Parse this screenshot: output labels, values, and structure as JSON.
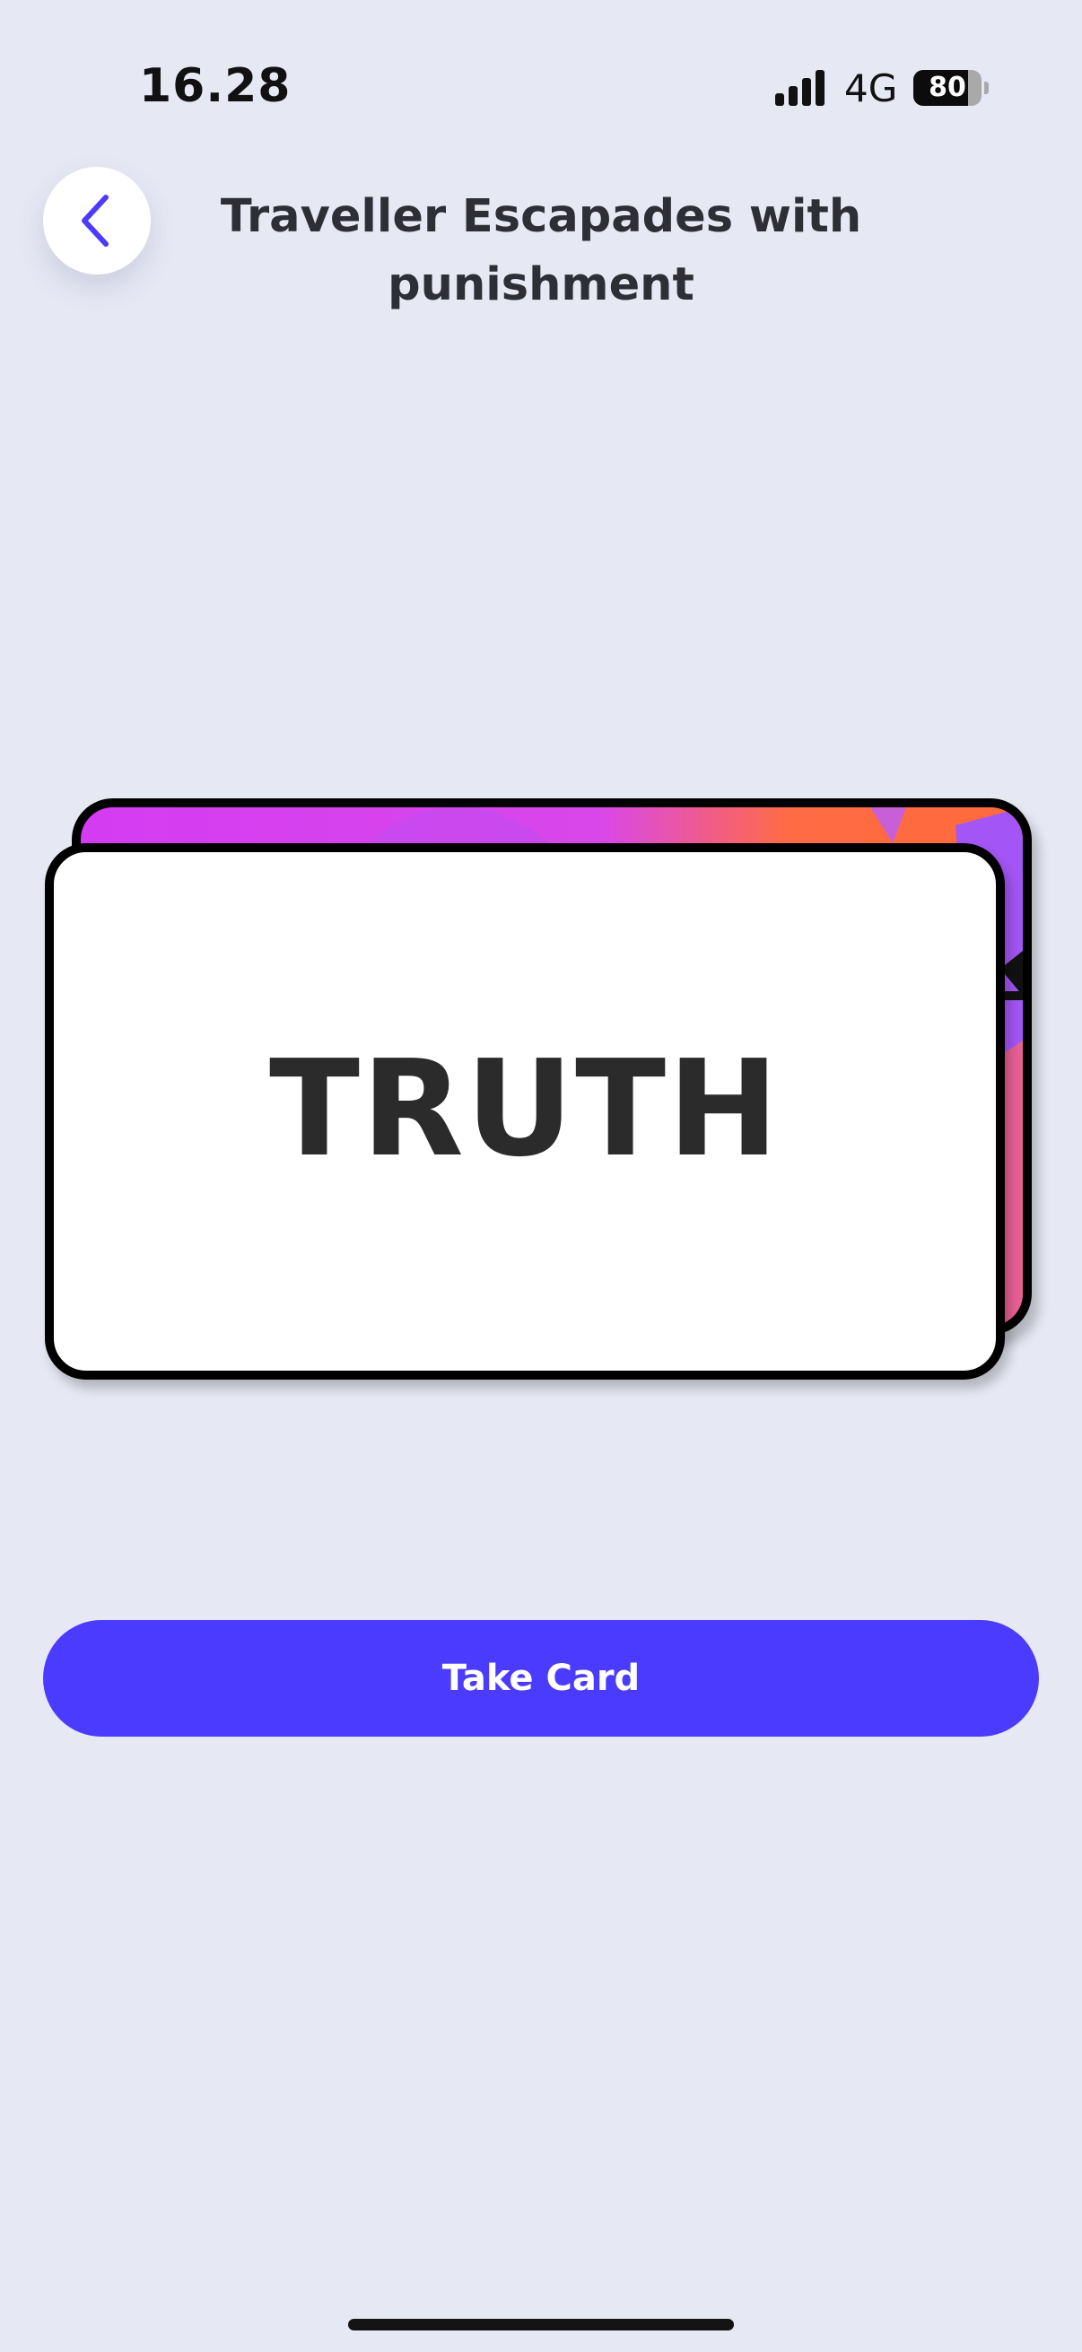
{
  "status_bar": {
    "time": "16.28",
    "network": "4G",
    "battery_percent": "80",
    "battery_level": 0.8,
    "signal_bars": 4
  },
  "header": {
    "back_icon": "chevron-left-icon",
    "title_line1": "Traveller Escapades with",
    "title_line2": "punishment"
  },
  "card": {
    "front_label": "TRUTH",
    "back_colors": [
      "#D43CF2",
      "#FF6B45",
      "#A855F7"
    ]
  },
  "actions": {
    "take_card_label": "Take Card"
  },
  "colors": {
    "background": "#E6E8F4",
    "accent": "#4B3BFE",
    "back_icon": "#4B3BFE"
  }
}
